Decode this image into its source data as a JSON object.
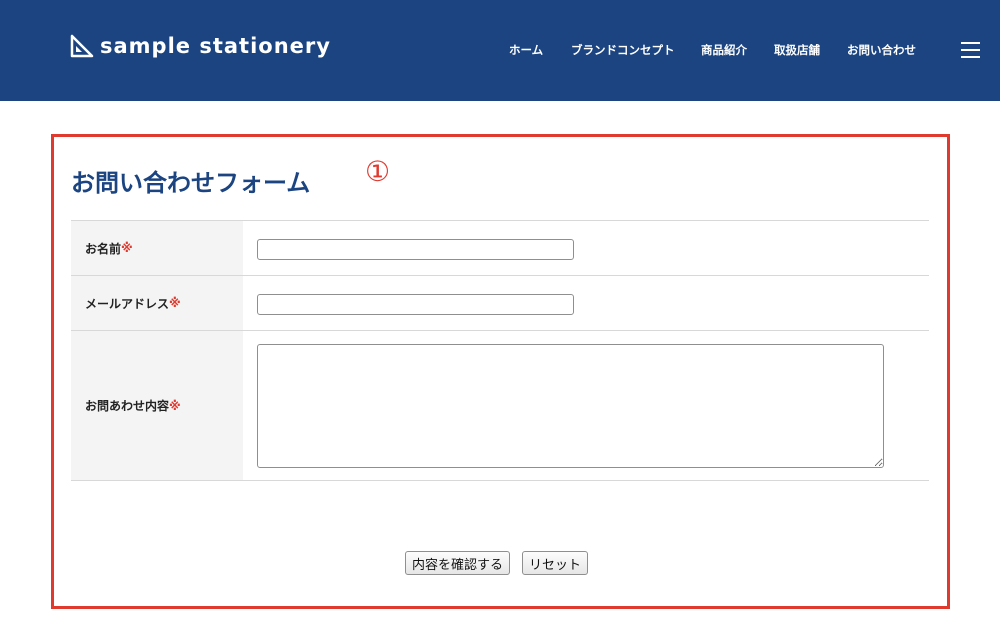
{
  "header": {
    "logo_text": "sample stationery",
    "logo_icon": "set-square-icon",
    "nav": [
      "ホーム",
      "ブランドコンセプト",
      "商品紹介",
      "取扱店舗",
      "お問い合わせ"
    ],
    "menu_icon": "hamburger-icon",
    "background": "#1b4481"
  },
  "annotation": {
    "marker": "①",
    "color": "#e03a2f"
  },
  "form": {
    "title": "お問い合わせフォーム",
    "fields": [
      {
        "label": "お名前",
        "required_mark": "※",
        "type": "text",
        "value": ""
      },
      {
        "label": "メールアドレス",
        "required_mark": "※",
        "type": "text",
        "value": ""
      },
      {
        "label": "お問あわせ内容",
        "required_mark": "※",
        "type": "textarea",
        "value": ""
      }
    ],
    "confirm_button": "内容を確認する",
    "reset_button": "リセット"
  }
}
